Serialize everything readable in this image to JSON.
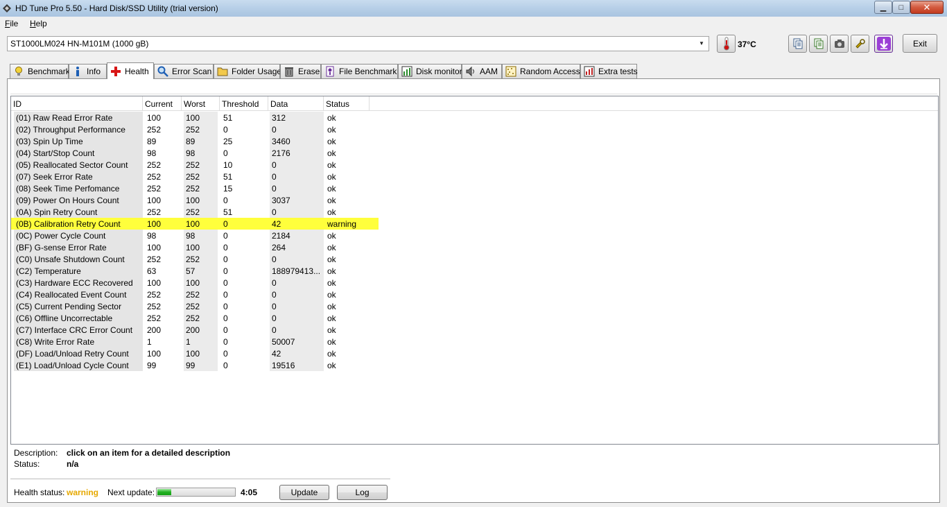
{
  "window": {
    "title": "HD Tune Pro 5.50 - Hard Disk/SSD Utility (trial version)",
    "minimize_glyph": "▁",
    "maximize_glyph": "□",
    "close_glyph": "✕"
  },
  "menu": {
    "file": {
      "accel": "F",
      "rest": "ile"
    },
    "help": {
      "accel": "H",
      "rest": "elp"
    }
  },
  "toolbar": {
    "drive": "ST1000LM024 HN-M101M (1000 gB)",
    "temperature": "37°C",
    "exit_label": "Exit",
    "icons": [
      "copy-info-icon",
      "copy-all-icon",
      "screenshot-icon",
      "options-icon",
      "save-icon"
    ]
  },
  "tabs": [
    {
      "label": "Benchmark",
      "icon": "bulb-icon"
    },
    {
      "label": "Info",
      "icon": "info-icon"
    },
    {
      "label": "Health",
      "icon": "cross-icon",
      "active": true
    },
    {
      "label": "Error Scan",
      "icon": "magnifier-icon"
    },
    {
      "label": "Folder Usage",
      "icon": "folder-icon"
    },
    {
      "label": "Erase",
      "icon": "trash-icon"
    },
    {
      "label": "File Benchmark",
      "icon": "file-benchmark-icon"
    },
    {
      "label": "Disk monitor",
      "icon": "chart-icon"
    },
    {
      "label": "AAM",
      "icon": "speaker-icon"
    },
    {
      "label": "Random Access",
      "icon": "dots-icon"
    },
    {
      "label": "Extra tests",
      "icon": "checklist-icon"
    }
  ],
  "health": {
    "columns": [
      "ID",
      "Current",
      "Worst",
      "Threshold",
      "Data",
      "Status"
    ],
    "rows": [
      {
        "id": "(01) Raw Read Error Rate",
        "current": "100",
        "worst": "100",
        "threshold": "51",
        "data": "312",
        "status": "ok"
      },
      {
        "id": "(02) Throughput Performance",
        "current": "252",
        "worst": "252",
        "threshold": "0",
        "data": "0",
        "status": "ok"
      },
      {
        "id": "(03) Spin Up Time",
        "current": "89",
        "worst": "89",
        "threshold": "25",
        "data": "3460",
        "status": "ok"
      },
      {
        "id": "(04) Start/Stop Count",
        "current": "98",
        "worst": "98",
        "threshold": "0",
        "data": "2176",
        "status": "ok"
      },
      {
        "id": "(05) Reallocated Sector Count",
        "current": "252",
        "worst": "252",
        "threshold": "10",
        "data": "0",
        "status": "ok"
      },
      {
        "id": "(07) Seek Error Rate",
        "current": "252",
        "worst": "252",
        "threshold": "51",
        "data": "0",
        "status": "ok"
      },
      {
        "id": "(08) Seek Time Perfomance",
        "current": "252",
        "worst": "252",
        "threshold": "15",
        "data": "0",
        "status": "ok"
      },
      {
        "id": "(09) Power On Hours Count",
        "current": "100",
        "worst": "100",
        "threshold": "0",
        "data": "3037",
        "status": "ok"
      },
      {
        "id": "(0A) Spin Retry Count",
        "current": "252",
        "worst": "252",
        "threshold": "51",
        "data": "0",
        "status": "ok"
      },
      {
        "id": "(0B) Calibration Retry Count",
        "current": "100",
        "worst": "100",
        "threshold": "0",
        "data": "42",
        "status": "warning",
        "warn": true
      },
      {
        "id": "(0C) Power Cycle Count",
        "current": "98",
        "worst": "98",
        "threshold": "0",
        "data": "2184",
        "status": "ok"
      },
      {
        "id": "(BF) G-sense Error Rate",
        "current": "100",
        "worst": "100",
        "threshold": "0",
        "data": "264",
        "status": "ok"
      },
      {
        "id": "(C0) Unsafe Shutdown Count",
        "current": "252",
        "worst": "252",
        "threshold": "0",
        "data": "0",
        "status": "ok"
      },
      {
        "id": "(C2) Temperature",
        "current": "63",
        "worst": "57",
        "threshold": "0",
        "data": "188979413...",
        "status": "ok"
      },
      {
        "id": "(C3) Hardware ECC Recovered",
        "current": "100",
        "worst": "100",
        "threshold": "0",
        "data": "0",
        "status": "ok"
      },
      {
        "id": "(C4) Reallocated Event Count",
        "current": "252",
        "worst": "252",
        "threshold": "0",
        "data": "0",
        "status": "ok"
      },
      {
        "id": "(C5) Current Pending Sector",
        "current": "252",
        "worst": "252",
        "threshold": "0",
        "data": "0",
        "status": "ok"
      },
      {
        "id": "(C6) Offline Uncorrectable",
        "current": "252",
        "worst": "252",
        "threshold": "0",
        "data": "0",
        "status": "ok"
      },
      {
        "id": "(C7) Interface CRC Error Count",
        "current": "200",
        "worst": "200",
        "threshold": "0",
        "data": "0",
        "status": "ok"
      },
      {
        "id": "(C8) Write Error Rate",
        "current": "1",
        "worst": "1",
        "threshold": "0",
        "data": "50007",
        "status": "ok"
      },
      {
        "id": "(DF) Load/Unload Retry Count",
        "current": "100",
        "worst": "100",
        "threshold": "0",
        "data": "42",
        "status": "ok"
      },
      {
        "id": "(E1) Load/Unload Cycle Count",
        "current": "99",
        "worst": "99",
        "threshold": "0",
        "data": "19516",
        "status": "ok"
      }
    ]
  },
  "details": {
    "description_label": "Description:",
    "description_value": "click on an item for a detailed description",
    "status_label": "Status:",
    "status_value": "n/a"
  },
  "footer": {
    "health_status_label": "Health status:",
    "health_status_value": "warning",
    "health_status_color": "#e6a800",
    "next_update_label": "Next update:",
    "next_update_progress": 0.18,
    "countdown": "4:05",
    "update_label": "Update",
    "log_label": "Log"
  }
}
